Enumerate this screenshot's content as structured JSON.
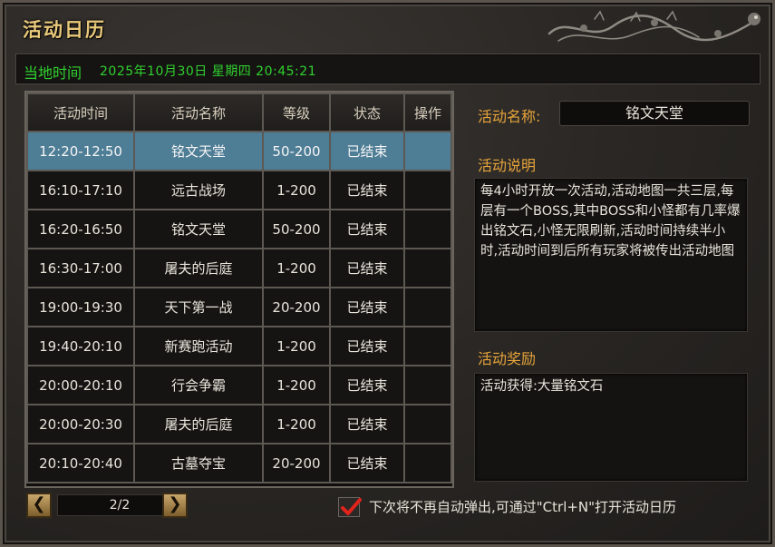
{
  "window": {
    "title": "活动日历"
  },
  "timebar": {
    "label": "当地时间",
    "value": "2025年10月30日 星期四 20:45:21"
  },
  "table": {
    "headers": [
      "活动时间",
      "活动名称",
      "等级",
      "状态",
      "操作"
    ],
    "rows": [
      {
        "time": "12:20-12:50",
        "name": "铭文天堂",
        "level": "50-200",
        "status": "已结束",
        "action": ""
      },
      {
        "time": "16:10-17:10",
        "name": "远古战场",
        "level": "1-200",
        "status": "已结束",
        "action": ""
      },
      {
        "time": "16:20-16:50",
        "name": "铭文天堂",
        "level": "50-200",
        "status": "已结束",
        "action": ""
      },
      {
        "time": "16:30-17:00",
        "name": "屠夫的后庭",
        "level": "1-200",
        "status": "已结束",
        "action": ""
      },
      {
        "time": "19:00-19:30",
        "name": "天下第一战",
        "level": "20-200",
        "status": "已结束",
        "action": ""
      },
      {
        "time": "19:40-20:10",
        "name": "新赛跑活动",
        "level": "1-200",
        "status": "已结束",
        "action": ""
      },
      {
        "time": "20:00-20:10",
        "name": "行会争霸",
        "level": "1-200",
        "status": "已结束",
        "action": ""
      },
      {
        "time": "20:00-20:30",
        "name": "屠夫的后庭",
        "level": "1-200",
        "status": "已结束",
        "action": ""
      },
      {
        "time": "20:10-20:40",
        "name": "古墓夺宝",
        "level": "20-200",
        "status": "已结束",
        "action": ""
      }
    ]
  },
  "details": {
    "name_label": "活动名称:",
    "name_value": "铭文天堂",
    "desc_label": "活动说明",
    "desc_text": "每4小时开放一次活动,活动地图一共三层,每层有一个BOSS,其中BOSS和小怪都有几率爆出铭文石,小怪无限刷新,活动时间持续半小时,活动时间到后所有玩家将被传出活动地图",
    "reward_label": "活动奖励",
    "reward_text": "活动获得:大量铭文石"
  },
  "pager": {
    "prev_icon": "chevron-left-icon",
    "next_icon": "chevron-right-icon",
    "text": "2/2"
  },
  "footer": {
    "checkbox_checked": true,
    "checkbox_label": "下次将不再自动弹出,可通过\"Ctrl+N\"打开活动日历"
  },
  "colors": {
    "title": "#e9c97a",
    "time_green": "#2fd12f",
    "section_orange": "#e7a43b",
    "selected_row": "#4e7d96"
  }
}
